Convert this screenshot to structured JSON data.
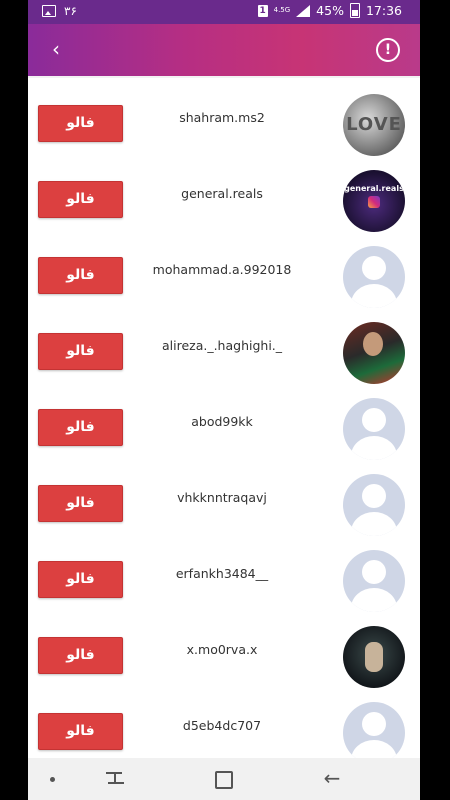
{
  "status_bar": {
    "left_text": "۳۶",
    "network": "4.5G",
    "battery": "45%",
    "time": "17:36",
    "sim_label": "1"
  },
  "toolbar": {
    "back_glyph": "‹",
    "info_glyph": "!"
  },
  "follow_label": "فالو",
  "users": [
    {
      "username": "shahram.ms2",
      "avatar": "photo-1",
      "avatar_text": "LOVE"
    },
    {
      "username": "general.reals",
      "avatar": "photo-2",
      "avatar_text": "general.reals"
    },
    {
      "username": "mohammad.a.992018",
      "avatar": "default"
    },
    {
      "username": "alireza._.haghighi._",
      "avatar": "photo-4"
    },
    {
      "username": "abod99kk",
      "avatar": "default"
    },
    {
      "username": "vhkknntraqavj",
      "avatar": "default"
    },
    {
      "username": "erfankh3484__",
      "avatar": "default"
    },
    {
      "username": "x.mo0rva.x",
      "avatar": "photo-8"
    },
    {
      "username": "d5eb4dc707",
      "avatar": "default"
    }
  ],
  "nav": {
    "back_glyph": "←"
  },
  "colors": {
    "follow_button": "#dc4040",
    "app_bar_gradient_start": "#8a2b9a",
    "app_bar_gradient_end": "#c73475",
    "default_avatar_bg": "#cfd6e6"
  }
}
